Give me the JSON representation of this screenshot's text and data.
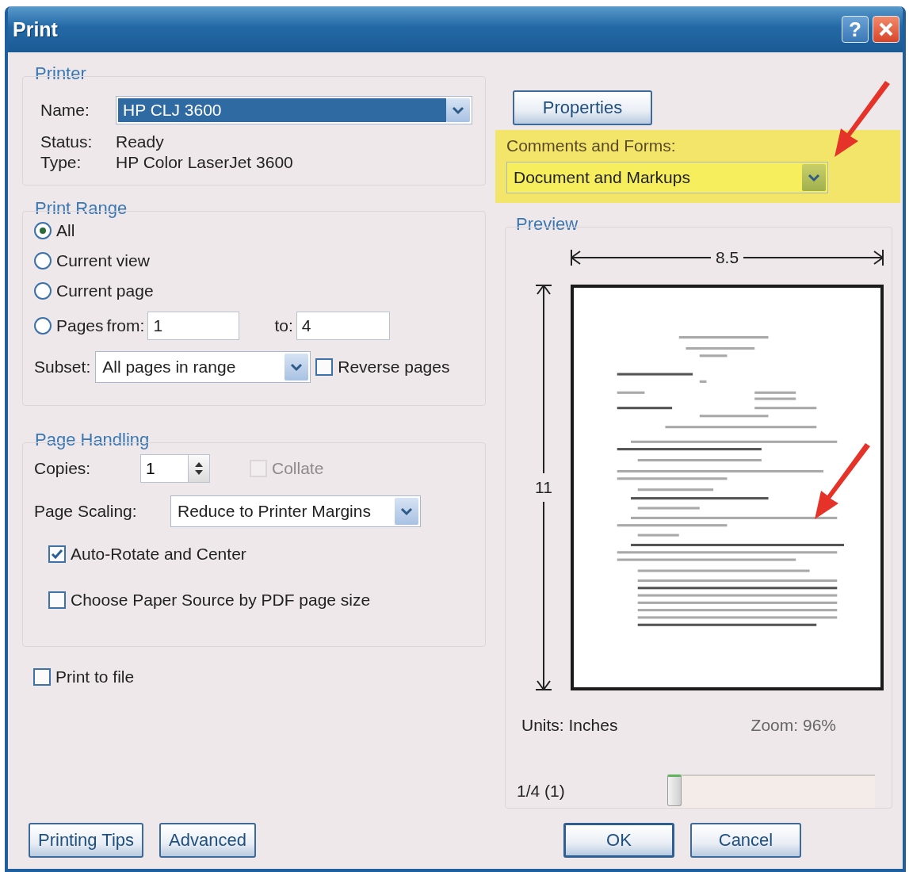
{
  "window": {
    "title": "Print",
    "title_buttons": [
      {
        "kind": "help",
        "label": "?"
      },
      {
        "kind": "close"
      }
    ]
  },
  "printer": {
    "title": "Printer",
    "name_label": "Name:",
    "name_value": "HP CLJ 3600",
    "status_label": "Status:",
    "status_value": "Ready",
    "type_label": "Type:",
    "type_value": "HP Color LaserJet 3600",
    "properties_button": "Properties",
    "comments_label": "Comments and Forms:",
    "comments_value": "Document and Markups"
  },
  "print_range": {
    "title": "Print Range",
    "options": [
      {
        "label": "All",
        "selected": true
      },
      {
        "label": "Current view",
        "selected": false
      },
      {
        "label": "Current page",
        "selected": false
      },
      {
        "label": "Pages",
        "selected": false
      }
    ],
    "from_label": "from:",
    "from_value": "1",
    "to_label": "to:",
    "to_value": "4",
    "subset_label": "Subset:",
    "subset_value": "All pages in range",
    "reverse": {
      "label": "Reverse pages",
      "checked": false
    }
  },
  "page_handling": {
    "title": "Page Handling",
    "copies_label": "Copies:",
    "copies_value": "1",
    "collate": {
      "label": "Collate",
      "checked": false,
      "disabled": true
    },
    "scaling_label": "Page Scaling:",
    "scaling_value": "Reduce to Printer Margins",
    "options": [
      {
        "label": "Auto-Rotate and Center",
        "checked": true
      },
      {
        "label": "Choose Paper Source by PDF page size",
        "checked": false
      }
    ]
  },
  "print_to_file": {
    "label": "Print to file",
    "checked": false
  },
  "preview": {
    "title": "Preview",
    "width_label": "8.5",
    "height_label": "11",
    "units": "Units: Inches",
    "zoom": "Zoom: 96%",
    "page_indicator": "1/4 (1)",
    "page_slider": {
      "level": 0
    }
  },
  "left_buttons": [
    {
      "label": "Printing Tips",
      "default": false
    },
    {
      "label": "Advanced",
      "default": false
    }
  ],
  "right_buttons": [
    {
      "label": "OK",
      "default": true
    },
    {
      "label": "Cancel",
      "default": false
    }
  ]
}
